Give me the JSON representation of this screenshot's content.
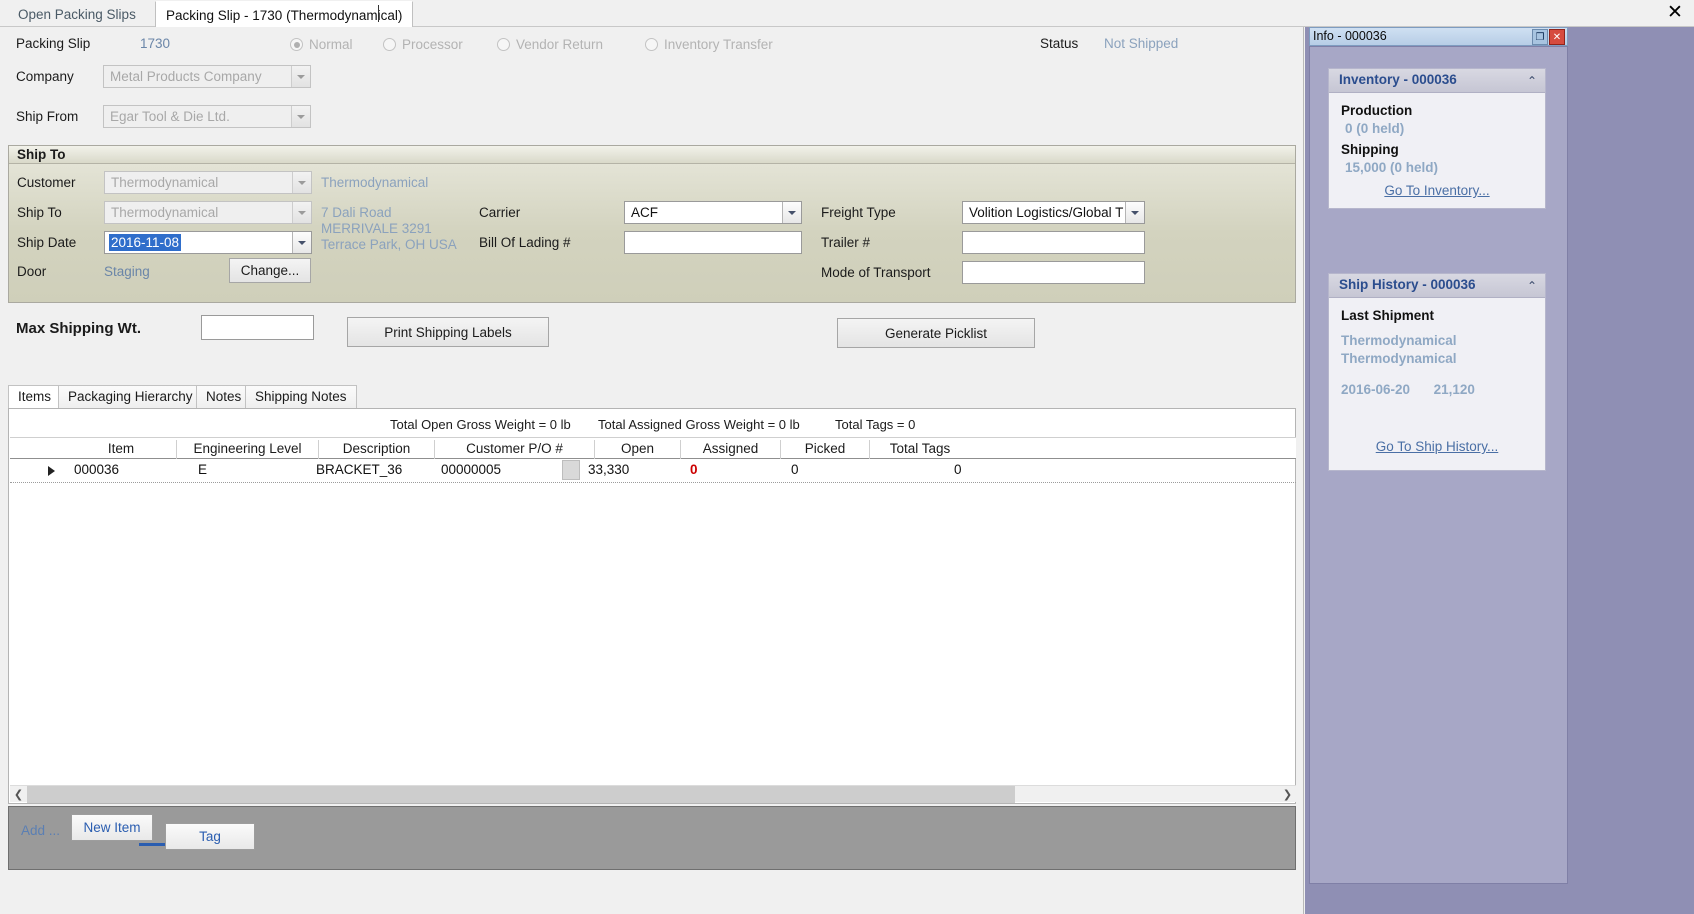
{
  "window": {
    "close_label": "✕"
  },
  "tabs": [
    {
      "label": "Open Packing Slips",
      "active": false
    },
    {
      "label": "Packing Slip - 1730 (Thermodynamical)",
      "active": true
    }
  ],
  "header": {
    "packing_slip_label": "Packing Slip",
    "packing_slip_value": "1730",
    "company_label": "Company",
    "company_value": "Metal Products Company",
    "ship_from_label": "Ship From",
    "ship_from_value": "Egar Tool & Die Ltd.",
    "status_label": "Status",
    "status_value": "Not Shipped",
    "types": [
      {
        "label": "Normal",
        "selected": true
      },
      {
        "label": "Processor",
        "selected": false
      },
      {
        "label": "Vendor Return",
        "selected": false
      },
      {
        "label": "Inventory Transfer",
        "selected": false
      }
    ]
  },
  "ship_to": {
    "group_title": "Ship To",
    "customer_label": "Customer",
    "customer_value": "Thermodynamical",
    "customer_display": "Thermodynamical",
    "ship_to_label": "Ship To",
    "ship_to_value": "Thermodynamical",
    "address_line1": "7 Dali Road",
    "address_line2": "MERRIVALE 3291",
    "address_line3": "Terrace Park, OH USA",
    "ship_date_label": "Ship Date",
    "ship_date_value": "2016-11-08",
    "door_label": "Door",
    "door_value": "Staging",
    "change_button": "Change...",
    "carrier_label": "Carrier",
    "carrier_value": "ACF",
    "bill_of_lading_label": "Bill Of Lading #",
    "bill_of_lading_value": "",
    "freight_type_label": "Freight Type",
    "freight_type_value": "Volition Logistics/Global T",
    "trailer_label": "Trailer #",
    "trailer_value": "",
    "mode_of_transport_label": "Mode of Transport",
    "mode_of_transport_value": ""
  },
  "actions": {
    "max_shipping_wt_label": "Max Shipping Wt.",
    "max_shipping_wt_value": "",
    "print_shipping_labels": "Print Shipping Labels",
    "generate_picklist": "Generate Picklist"
  },
  "grid_tabs": [
    {
      "label": "Items",
      "active": true
    },
    {
      "label": "Packaging Hierarchy",
      "active": false
    },
    {
      "label": "Notes",
      "active": false
    },
    {
      "label": "Shipping Notes",
      "active": false
    }
  ],
  "totals": {
    "open_gross_weight": "Total Open Gross Weight = 0 lb",
    "assigned_gross_weight": "Total Assigned Gross Weight = 0 lb",
    "total_tags": "Total Tags = 0"
  },
  "grid": {
    "columns": [
      "Item",
      "Engineering Level",
      "Description",
      "Customer P/O #",
      "Open",
      "Assigned",
      "Picked",
      "Total Tags"
    ],
    "rows": [
      {
        "item": "000036",
        "engineering_level": "E",
        "description": "BRACKET_36",
        "customer_po": "00000005",
        "open": "33,330",
        "assigned": "0",
        "picked": "0",
        "total_tags": "0"
      }
    ]
  },
  "bottom_bar": {
    "add_link": "Add ...",
    "new_item_button": "New Item",
    "tag_button": "Tag"
  },
  "dock": {
    "title": "Info - 000036",
    "restore_icon": "❐",
    "close_icon": "✕",
    "inventory": {
      "title": "Inventory - 000036",
      "collapse_icon": "⌃",
      "production_label": "Production",
      "production_value": "0 (0 held)",
      "shipping_label": "Shipping",
      "shipping_value": "15,000 (0 held)",
      "link": "Go To Inventory..."
    },
    "ship_history": {
      "title": "Ship History - 000036",
      "collapse_icon": "⌃",
      "last_shipment_label": "Last Shipment",
      "customer_line1": "Thermodynamical",
      "customer_line2": "Thermodynamical",
      "date": "2016-06-20",
      "quantity": "21,120",
      "link": "Go To Ship History..."
    }
  },
  "colors": {
    "accent_blue": "#6b86a8",
    "link_blue": "#2a5db0",
    "alert_red": "#cc0000"
  }
}
